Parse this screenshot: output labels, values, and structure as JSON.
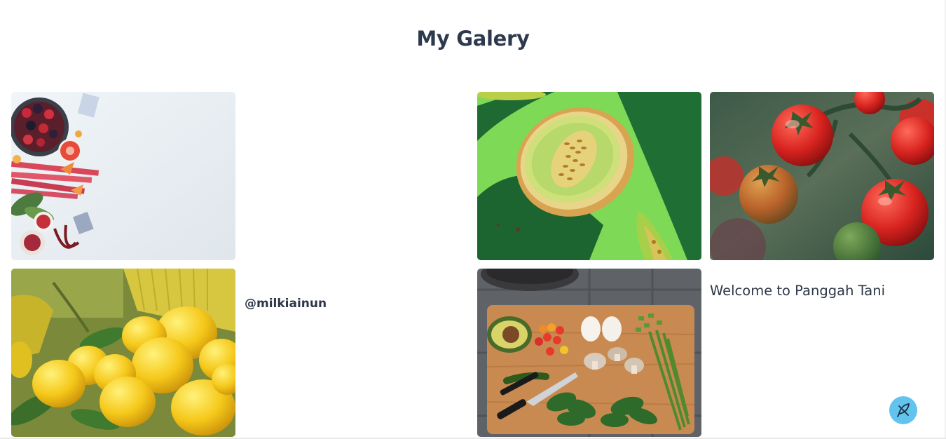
{
  "page": {
    "title": "My Galery"
  },
  "gallery": {
    "handle": "@milkiainun",
    "welcome": "Welcome to Panggah Tani",
    "photos": [
      {
        "name": "fruits-flatlay-photo"
      },
      {
        "name": "melon-photo"
      },
      {
        "name": "tomatoes-photo"
      },
      {
        "name": "lemons-photo"
      },
      {
        "name": "cutting-board-photo"
      }
    ]
  },
  "fab": {
    "icon": "feather-quill-icon",
    "color": "#62c3ee"
  }
}
